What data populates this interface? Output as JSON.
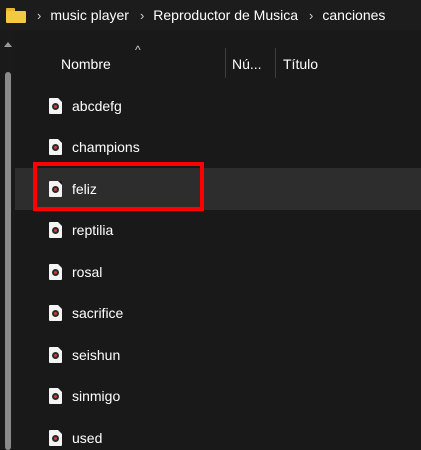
{
  "breadcrumb": {
    "items": [
      "music player",
      "Reproductor de Musica",
      "canciones"
    ]
  },
  "columns": {
    "sort_indicator": "^",
    "name": "Nombre",
    "number": "Nú...",
    "title": "Título"
  },
  "files": [
    {
      "name": "abcdefg"
    },
    {
      "name": "champions"
    },
    {
      "name": "feliz"
    },
    {
      "name": "reptilia"
    },
    {
      "name": "rosal"
    },
    {
      "name": "sacrifice"
    },
    {
      "name": "seishun"
    },
    {
      "name": "sinmigo"
    },
    {
      "name": "used"
    }
  ],
  "hovered_file": "feliz",
  "colors": {
    "background": "#191919",
    "hover_row": "#2d2d2d",
    "folder": "#f5c842",
    "highlight": "#ff0000"
  }
}
